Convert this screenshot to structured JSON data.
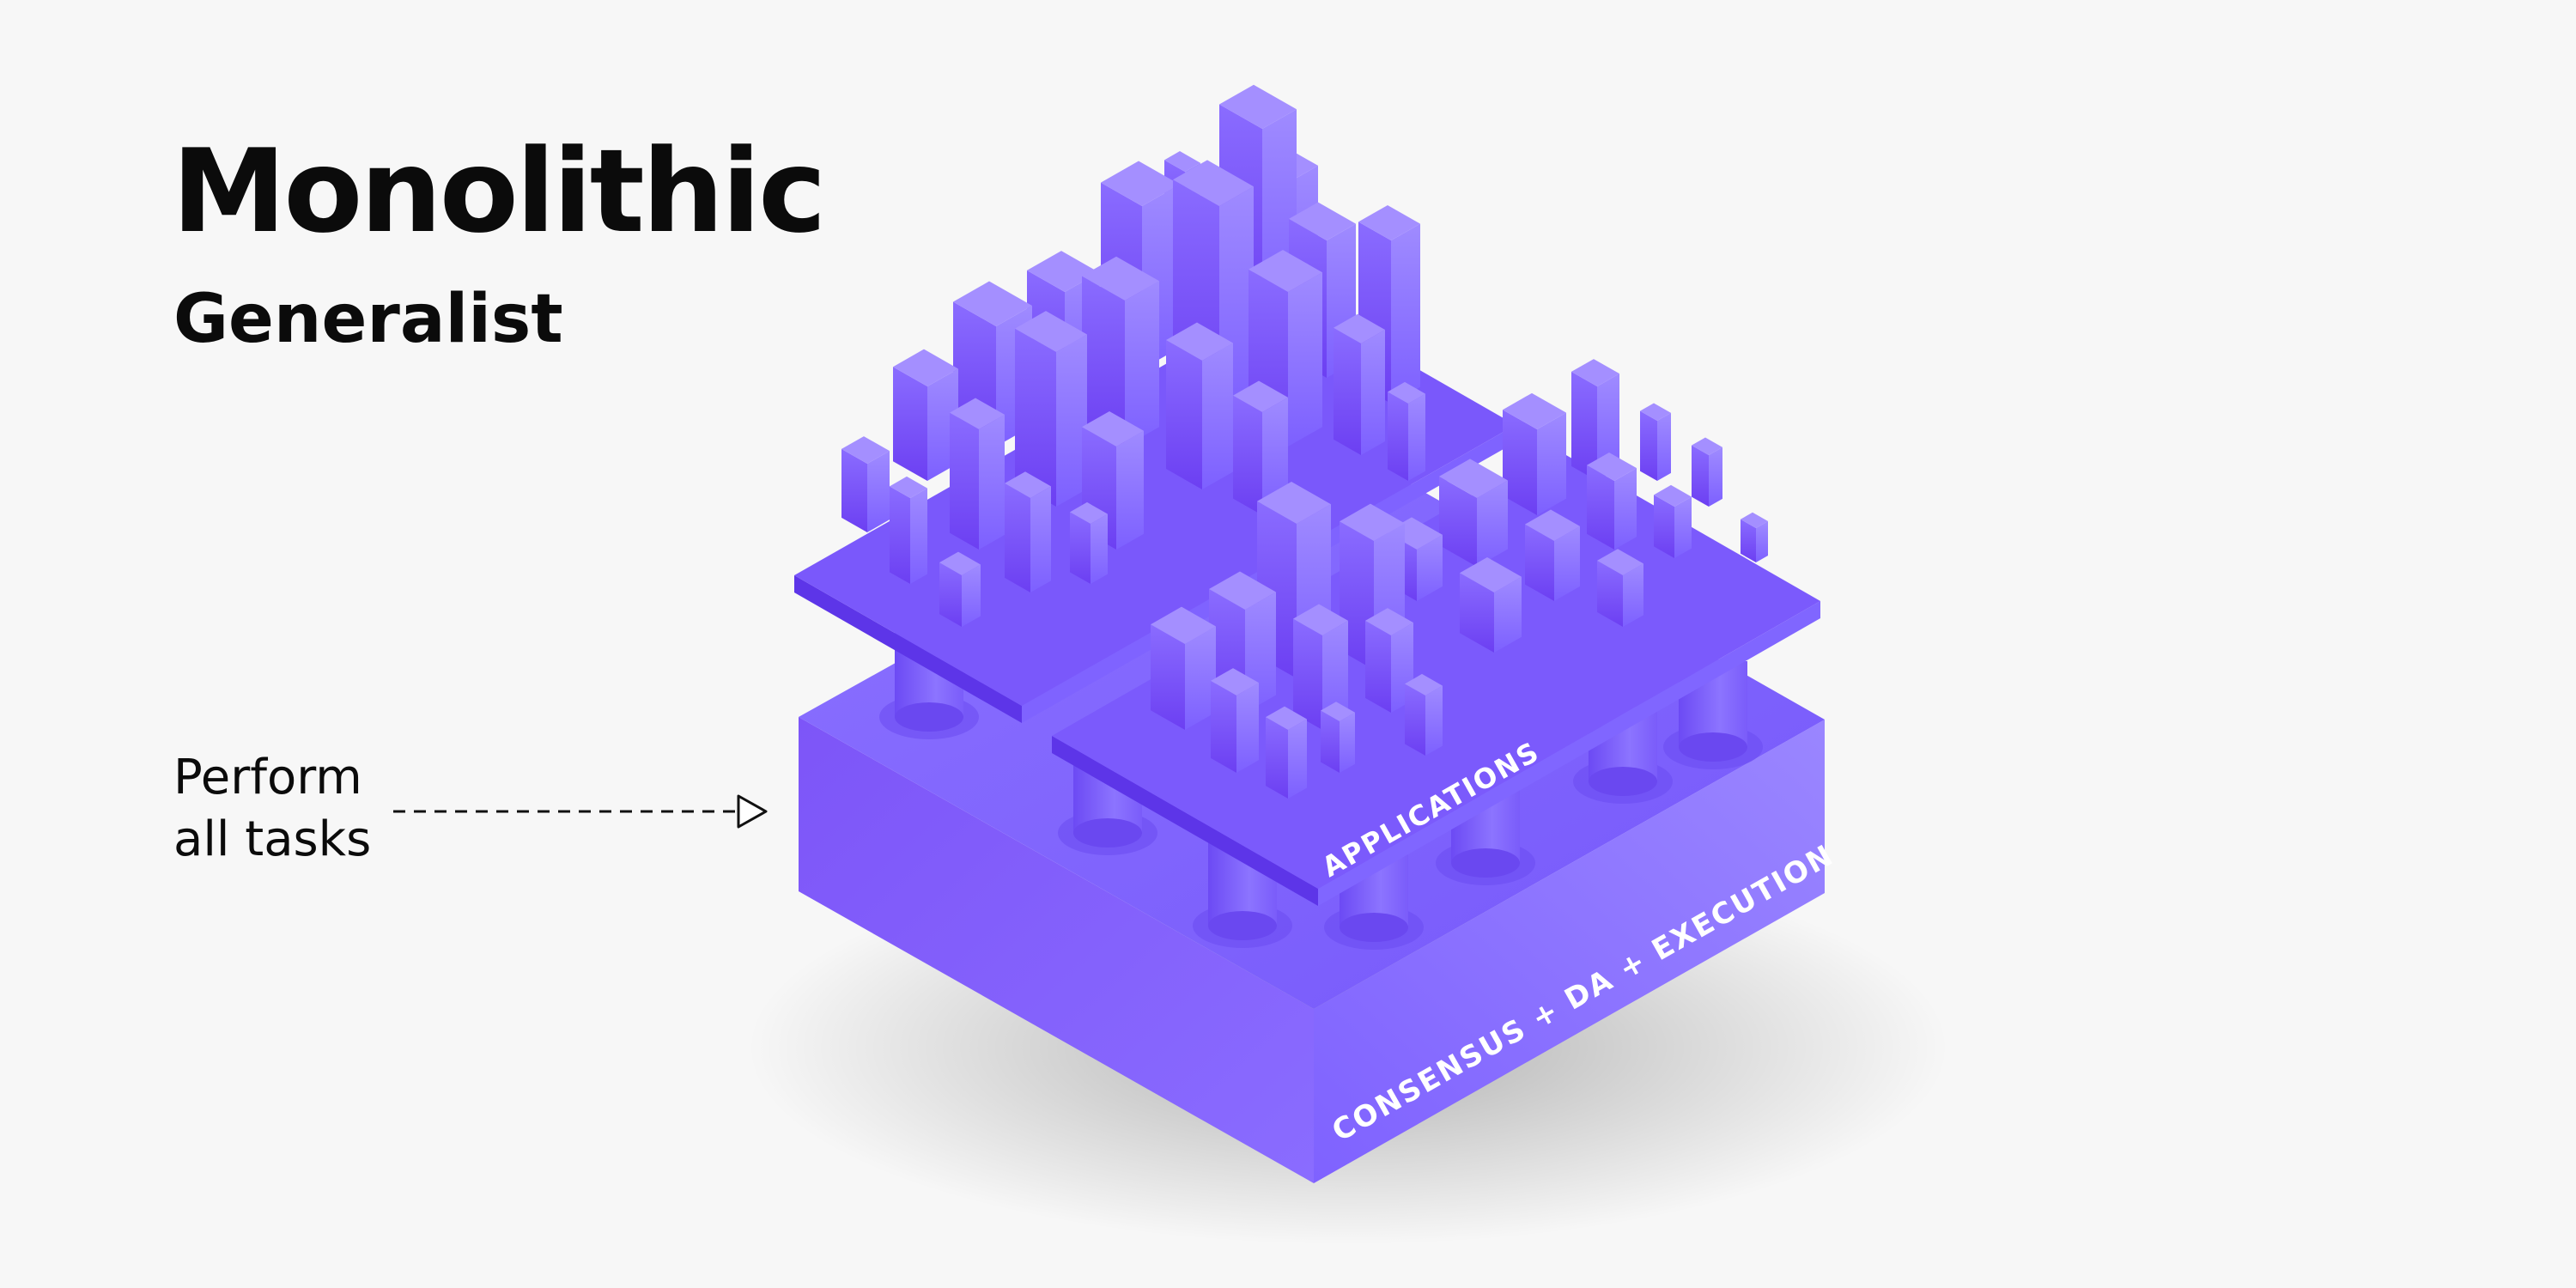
{
  "title": "Monolithic",
  "subtitle": "Generalist",
  "annotation": {
    "line1": "Perform",
    "line2": "all tasks"
  },
  "labels": {
    "applications": "APPLICATIONS",
    "base_layer": "CONSENSUS + DA + EXECUTION"
  },
  "colors": {
    "background": "#f7f7f7",
    "accent": "#7b5cff",
    "accent_dark": "#6a46f5",
    "accent_light": "#9a82ff",
    "text": "#0b0b0b"
  }
}
